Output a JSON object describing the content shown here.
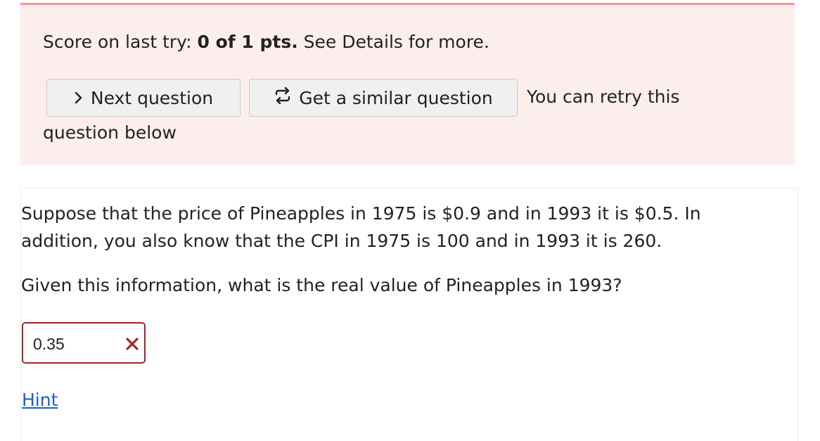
{
  "score": {
    "prefix": "Score on last try: ",
    "value": "0 of 1 pts.",
    "suffix": " See Details for more."
  },
  "actions": {
    "next_label": "Next question",
    "similar_label": "Get a similar question",
    "retry_line1": "You can retry this",
    "retry_line2": "question below"
  },
  "question": {
    "text": "Suppose that the price of Pineapples in 1975 is $0.9 and in 1993 it is $0.5. In addition, you also know that the CPI in 1975 is 100 and in 1993 it is 260.",
    "prompt": "Given this information, what is the real value of Pineapples in 1993?",
    "answer": "0.35",
    "hint_label": "Hint"
  },
  "colors": {
    "score_bg": "#fdeeee",
    "score_border": "#f29a92",
    "error_red": "#a3242a",
    "link_blue": "#1a5fd0"
  },
  "icons": {
    "next": "chevron-right-icon",
    "similar": "repeat-icon",
    "incorrect": "close-icon"
  }
}
